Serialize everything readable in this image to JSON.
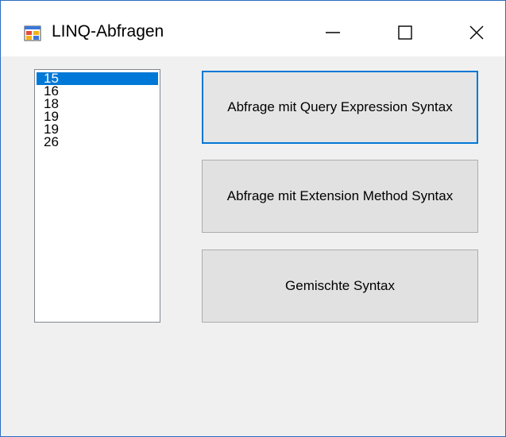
{
  "window": {
    "title": "LINQ-Abfragen",
    "icon": "winforms-app-icon",
    "controls": {
      "minimize_icon": "minimize-icon",
      "maximize_icon": "maximize-icon",
      "close_icon": "close-icon"
    }
  },
  "listbox": {
    "items": [
      "15",
      "16",
      "18",
      "19",
      "19",
      "26"
    ],
    "selected_index": 0
  },
  "buttons": {
    "query_expression": "Abfrage mit Query Expression Syntax",
    "extension_method": "Abfrage mit Extension Method Syntax",
    "mixed": "Gemischte Syntax"
  },
  "colors": {
    "accent": "#0078d7",
    "window_border": "#2b6cbf",
    "button_face": "#e1e1e1",
    "form_background": "#f0f0f0"
  }
}
